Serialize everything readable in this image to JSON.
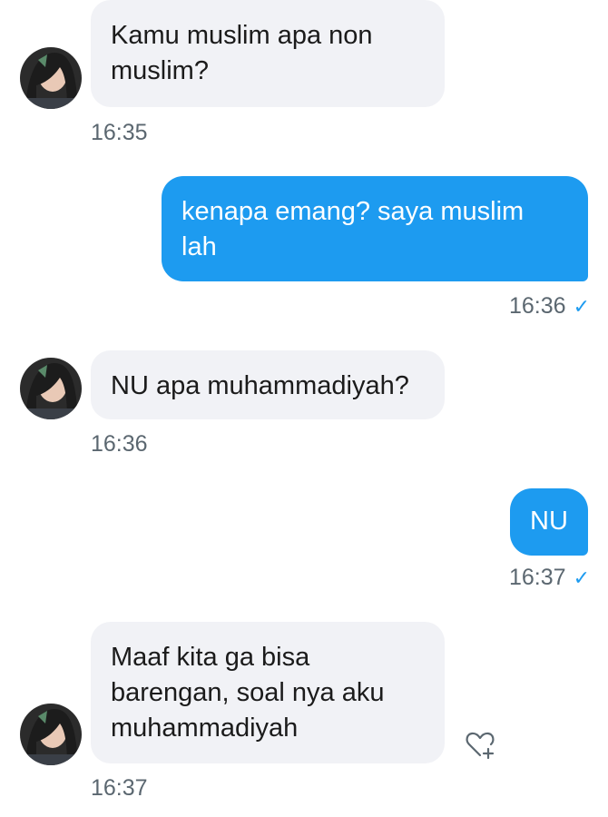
{
  "messages": [
    {
      "direction": "in",
      "text": "Kamu muslim apa non\nmuslim?",
      "time": "16:35"
    },
    {
      "direction": "out",
      "text": "kenapa emang? saya muslim\nlah",
      "time": "16:36"
    },
    {
      "direction": "in",
      "text": "NU apa muhammadiyah?",
      "time": "16:36"
    },
    {
      "direction": "out",
      "text": "NU",
      "time": "16:37"
    },
    {
      "direction": "in",
      "text": "Maaf kita ga bisa\nbarengan, soal nya aku\nmuhammadiyah",
      "time": "16:37"
    }
  ],
  "icons": {
    "read_check": "✓",
    "react": "heart-plus-icon",
    "avatar": "avatar-photo"
  },
  "colors": {
    "outgoing_bubble": "#1d9bf0",
    "incoming_bubble": "#f1f2f6",
    "timestamp": "#5b6770",
    "check": "#1d9bf0"
  }
}
